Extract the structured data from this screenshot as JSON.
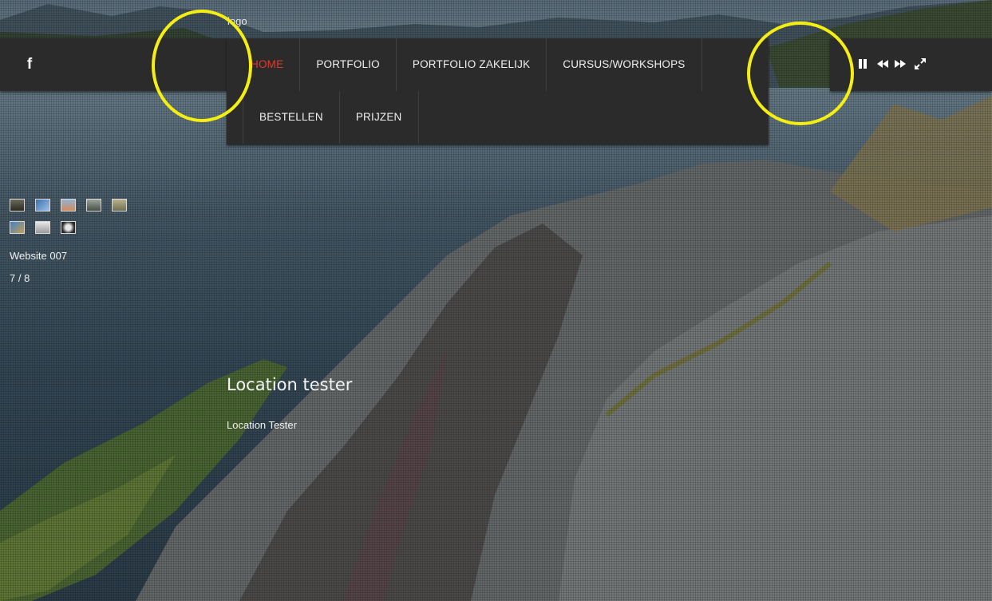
{
  "logo": {
    "text": "logo"
  },
  "social": {
    "facebook_icon": "facebook-icon"
  },
  "nav": {
    "row1": [
      {
        "label": "HOME",
        "active": true
      },
      {
        "label": "PORTFOLIO"
      },
      {
        "label": "PORTFOLIO ZAKELIJK"
      },
      {
        "label": "CURSUS/WORKSHOPS"
      }
    ],
    "row2": [
      {
        "label": "BESTELLEN"
      },
      {
        "label": "PRIJZEN"
      }
    ],
    "active_color": "#e0392b"
  },
  "slideshow_controls": {
    "icons": [
      "pause-icon",
      "previous-icon",
      "next-icon",
      "fullscreen-icon"
    ]
  },
  "slideshow": {
    "thumbnail_count": 8,
    "current_title": "Website 007",
    "counter": "7 / 8"
  },
  "caption": {
    "title": "Location tester",
    "text": "Location Tester"
  },
  "annotation": {
    "highlight_color": "#f5ee12"
  }
}
